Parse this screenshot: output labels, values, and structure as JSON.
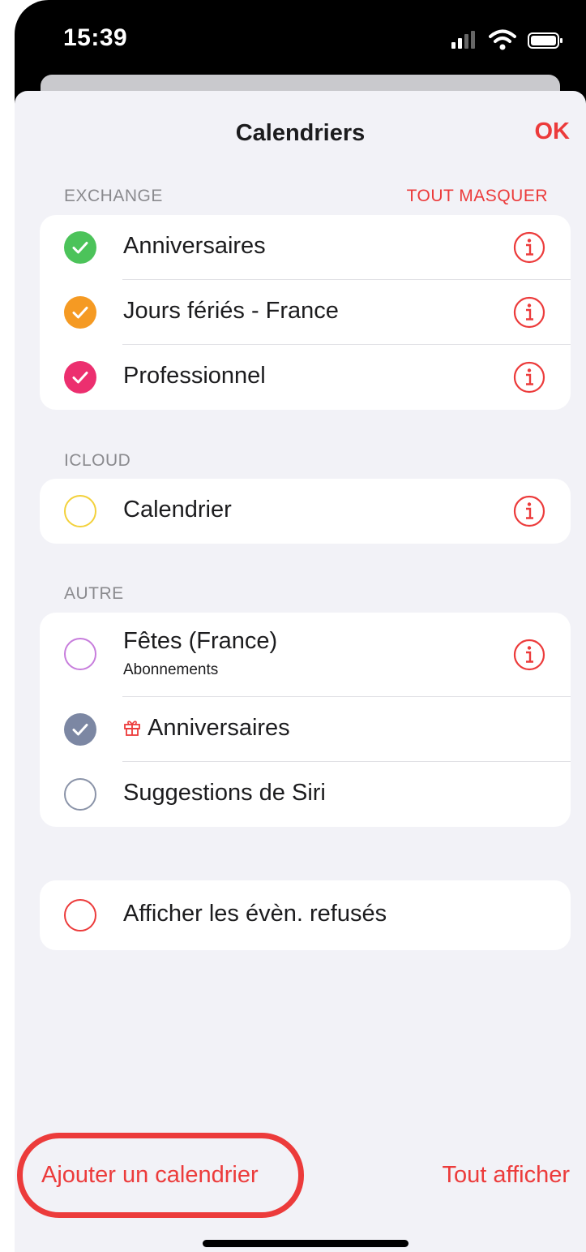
{
  "status_bar": {
    "time": "15:39",
    "icons": [
      "signal-icon",
      "wifi-icon",
      "battery-icon"
    ]
  },
  "nav": {
    "title": "Calendriers",
    "done_label": "OK"
  },
  "sections": {
    "exchange": {
      "header": "EXCHANGE",
      "action": "TOUT MASQUER",
      "items": [
        {
          "label": "Anniversaires",
          "checked": true,
          "color": "#4cc35a"
        },
        {
          "label": "Jours fériés - France",
          "checked": true,
          "color": "#f59a23"
        },
        {
          "label": "Professionnel",
          "checked": true,
          "color": "#ec2f6f"
        }
      ]
    },
    "icloud": {
      "header": "ICLOUD",
      "items": [
        {
          "label": "Calendrier",
          "checked": false,
          "color": "#f3d13b"
        }
      ]
    },
    "autre": {
      "header": "AUTRE",
      "items": [
        {
          "label": "Fêtes (France)",
          "sublabel": "Abonnements",
          "checked": false,
          "color": "#c77ddc"
        },
        {
          "label": "Anniversaires",
          "checked": true,
          "color": "#7c87a3",
          "icon": "gift-icon"
        },
        {
          "label": "Suggestions de Siri",
          "checked": false,
          "color": "#8a93a8"
        }
      ]
    },
    "declined": {
      "items": [
        {
          "label": "Afficher les évèn. refusés",
          "checked": false,
          "color": "#ec3b3b"
        }
      ]
    }
  },
  "footer": {
    "add_calendar": "Ajouter un calendrier",
    "show_all": "Tout afficher"
  },
  "colors": {
    "accent": "#ec3b3b",
    "background": "#f2f2f7"
  }
}
